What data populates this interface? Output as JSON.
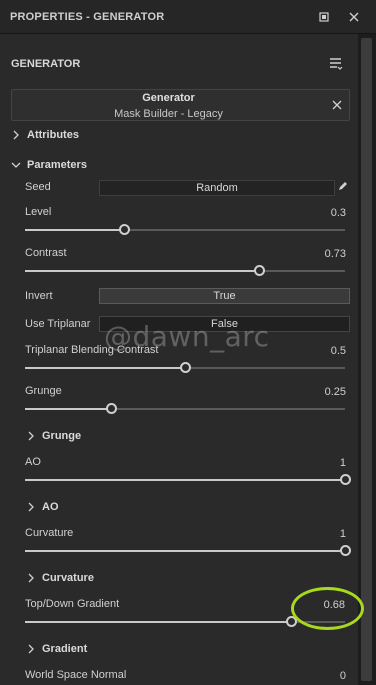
{
  "window": {
    "title": "PROPERTIES - GENERATOR"
  },
  "header": {
    "title": "GENERATOR"
  },
  "generator": {
    "name": "Generator",
    "subtitle": "Mask Builder - Legacy"
  },
  "sections": {
    "attributes": "Attributes",
    "parameters": "Parameters",
    "grunge": "Grunge",
    "ao": "AO",
    "curvature": "Curvature",
    "gradient": "Gradient"
  },
  "params": {
    "seed": {
      "label": "Seed",
      "value": "Random"
    },
    "level": {
      "label": "Level",
      "value": "0.3",
      "fraction": 0.31
    },
    "contrast": {
      "label": "Contrast",
      "value": "0.73",
      "fraction": 0.73
    },
    "invert": {
      "label": "Invert",
      "value": "True"
    },
    "use_triplanar": {
      "label": "Use Triplanar",
      "value": "False"
    },
    "triplanar_blending": {
      "label": "Triplanar Blending Contrast",
      "value": "0.5",
      "fraction": 0.5
    },
    "grunge": {
      "label": "Grunge",
      "value": "0.25",
      "fraction": 0.27
    },
    "ao": {
      "label": "AO",
      "value": "1",
      "fraction": 1.0
    },
    "curvature": {
      "label": "Curvature",
      "value": "1",
      "fraction": 1.0
    },
    "top_down_gradient": {
      "label": "Top/Down Gradient",
      "value": "0.68",
      "fraction": 0.83
    },
    "world_space_normal": {
      "label": "World Space Normal",
      "value": "0"
    }
  },
  "watermark": "@dawn_arc",
  "colors": {
    "highlight": "#a8d81f",
    "panel": "#2a2a2a",
    "titlebar": "#262626"
  },
  "icons": [
    "restore-icon",
    "close-icon",
    "menu-list-icon",
    "clear-icon",
    "chevron-right-icon",
    "chevron-down-icon",
    "pencil-icon"
  ]
}
